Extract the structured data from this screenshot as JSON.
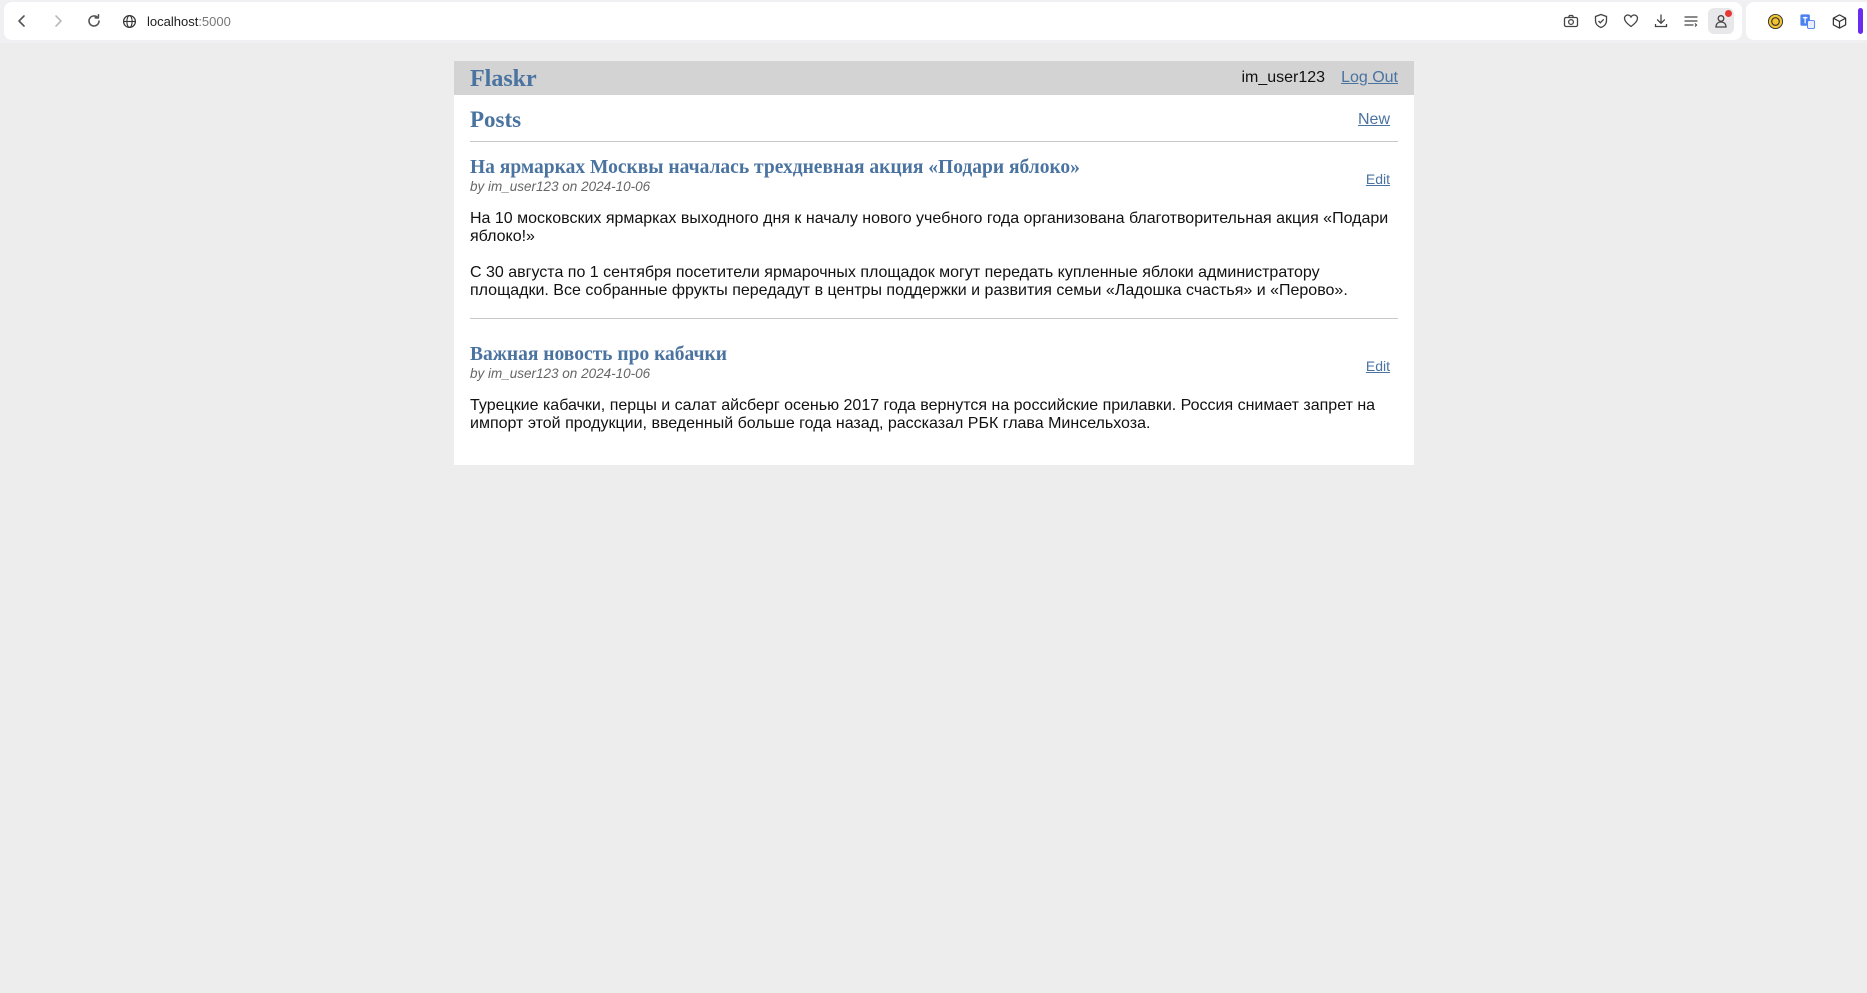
{
  "browser": {
    "url_host": "localhost",
    "url_port": ":5000"
  },
  "app": {
    "brand": "Flaskr",
    "username": "im_user123",
    "logout_label": "Log Out",
    "page_title": "Posts",
    "new_label": "New"
  },
  "posts": [
    {
      "title": "На ярмарках Москвы началась трехдневная акция «Подари яблоко»",
      "about": "by im_user123 on 2024-10-06",
      "edit_label": "Edit",
      "body": "На 10 московских ярмарках выходного дня к началу нового учебного года организована благотворительная акция «Подари яблоко!»\n\nС 30 августа по 1 сентября посетители ярмарочных площадок могут передать купленные яблоки администратору площадки. Все собранные фрукты передадут в центры поддержки и развития семьи «Ладошка счастья» и «Перово»."
    },
    {
      "title": "Важная новость про кабачки",
      "about": "by im_user123 on 2024-10-06",
      "edit_label": "Edit",
      "body": "Турецкие кабачки, перцы и салат айсберг осенью 2017 года вернутся на российские прилавки. Россия снимает запрет на импорт этой продукции, введенный больше года назад, рассказал РБК глава Минсельхоза."
    }
  ]
}
